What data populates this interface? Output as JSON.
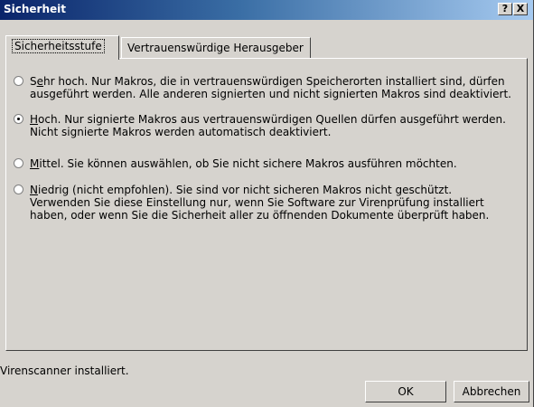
{
  "window": {
    "title": "Sicherheit",
    "help_label": "?",
    "close_label": "X"
  },
  "tabs": [
    {
      "label": "Sicherheitsstufe",
      "active": true
    },
    {
      "label": "Vertrauenswürdige Herausgeber",
      "active": false
    }
  ],
  "options": [
    {
      "label_prefix": "S",
      "label_accel": "e",
      "label_rest": "hr hoch. Nur Makros, die in vertrauenswürdigen Speicherorten installiert sind, dürfen ausgeführt werden. Alle anderen signierten und nicht signierten Makros sind deaktiviert.",
      "checked": false
    },
    {
      "label_prefix": "",
      "label_accel": "H",
      "label_rest": "och. Nur signierte Makros aus vertrauenswürdigen Quellen dürfen ausgeführt werden. Nicht signierte Makros werden automatisch deaktiviert.",
      "checked": true
    },
    {
      "label_prefix": "",
      "label_accel": "M",
      "label_rest": "ittel. Sie können auswählen, ob Sie nicht sichere Makros ausführen möchten.",
      "checked": false
    },
    {
      "label_prefix": "",
      "label_accel": "N",
      "label_rest": "iedrig (nicht empfohlen). Sie sind vor nicht sicheren Makros nicht geschützt. Verwenden Sie diese Einstellung nur, wenn Sie Software zur Virenprüfung installiert haben, oder wenn Sie die Sicherheit aller zu öffnenden Dokumente überprüft haben.",
      "checked": false
    }
  ],
  "status_text": "Virenscanner installiert.",
  "buttons": {
    "ok_label": "OK",
    "cancel_label": "Abbrechen"
  },
  "colors": {
    "dialog_face": "#d6d3ce",
    "titlebar_start": "#0a246a",
    "titlebar_end": "#a6caf0"
  }
}
